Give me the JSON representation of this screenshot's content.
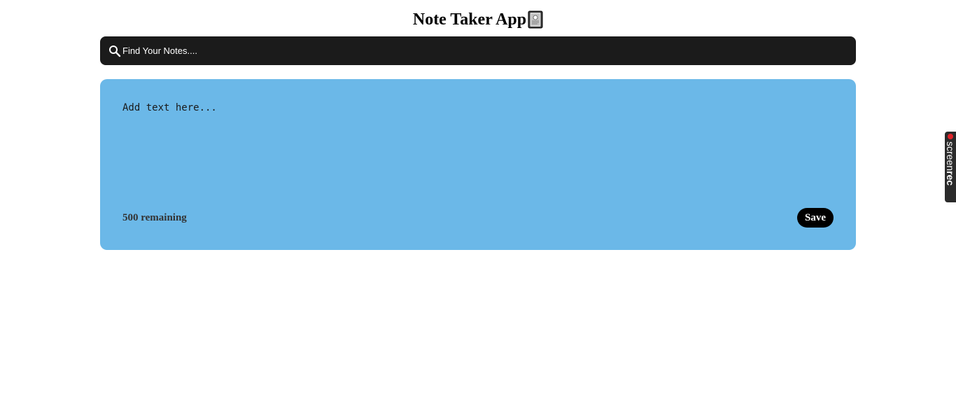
{
  "header": {
    "title": "Note Taker App",
    "icon": "notebook-icon"
  },
  "search": {
    "placeholder": "Find Your Notes....",
    "value": "",
    "icon": "search-icon"
  },
  "note": {
    "placeholder": "Add text here...",
    "value": "",
    "remaining_text": "500 remaining",
    "save_label": "Save"
  },
  "overlay": {
    "brand_light": "screen",
    "brand_bold": "rec",
    "icon": "record-dot-icon"
  },
  "colors": {
    "search_bg": "#1b1b1b",
    "note_bg": "#6bb8e8",
    "save_bg": "#000000",
    "rec_dot": "#e0242a"
  }
}
